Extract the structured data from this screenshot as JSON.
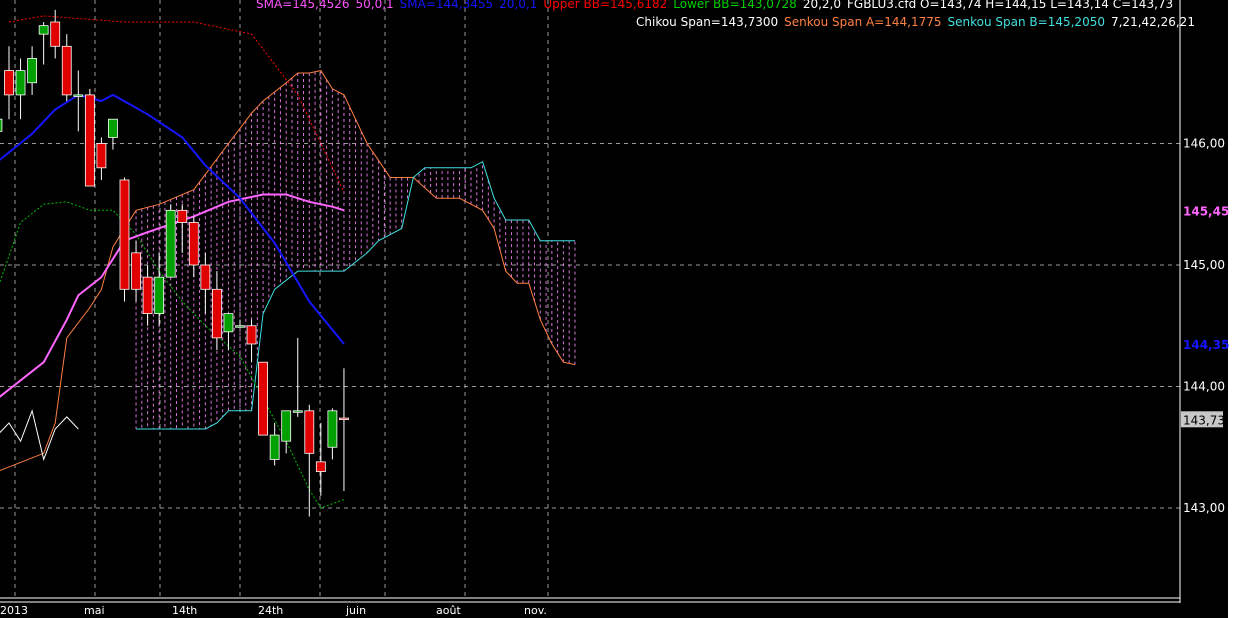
{
  "chart_data": {
    "type": "candlestick",
    "instrument": "FGBLU3.cfd",
    "ohlc_label": "O=143,74 H=144,15 L=143,14 C=143,73",
    "ylim": [
      142.0,
      146.95
    ],
    "grid": true,
    "y_ticks": [
      {
        "label": "146,00",
        "value": 146.0
      },
      {
        "label": "145,00",
        "value": 145.0
      },
      {
        "label": "144,00",
        "value": 144.0
      },
      {
        "label": "143,00",
        "value": 143.0
      }
    ],
    "x_labels": [
      "2013",
      "mai",
      "14th",
      "24th",
      "juin",
      "août",
      "nov."
    ],
    "legends_line1": [
      {
        "text": "SMA=145,4526",
        "color": "#ff55ff"
      },
      {
        "text": "50,0,1",
        "color": "#ff55ff"
      },
      {
        "text": "SMA=144,3455",
        "color": "#1515ff"
      },
      {
        "text": "20,0,1",
        "color": "#1515ff"
      },
      {
        "text": "Upper BB=145,6182",
        "color": "#ff0000"
      },
      {
        "text": "Lower BB=143,0728",
        "color": "#00d000"
      },
      {
        "text": "20,2,0",
        "color": "#ffffff"
      },
      {
        "text": "FGBLU3.cfd O=143,74 H=144,15 L=143,14 C=143,73",
        "color": "#ffffff"
      }
    ],
    "legends_line2": [
      {
        "text": "Chikou Span=143,7300",
        "color": "#ffffff"
      },
      {
        "text": "Senkou Span A=144,1775",
        "color": "#ff8040"
      },
      {
        "text": "Senkou Span B=145,2050",
        "color": "#40e0e0"
      },
      {
        "text": "7,21,42,26,21",
        "color": "#ffffff"
      }
    ],
    "value_tags": [
      {
        "label": "145,45",
        "value": 145.45,
        "color": "#ff66ff"
      },
      {
        "label": "144,35",
        "value": 144.35,
        "color": "#1515ff"
      }
    ],
    "last_price": {
      "label": "143,73",
      "value": 143.73
    },
    "candles": [
      {
        "i": -1,
        "o": 146.1,
        "h": 146.5,
        "l": 145.95,
        "c": 146.2
      },
      {
        "i": 0,
        "o": 146.6,
        "h": 146.8,
        "l": 146.2,
        "c": 146.4
      },
      {
        "i": 1,
        "o": 146.4,
        "h": 146.7,
        "l": 146.2,
        "c": 146.6
      },
      {
        "i": 2,
        "o": 146.5,
        "h": 146.8,
        "l": 146.4,
        "c": 146.7
      },
      {
        "i": 3,
        "o": 146.9,
        "h": 147.0,
        "l": 146.65,
        "c": 146.97
      },
      {
        "i": 4,
        "o": 147.0,
        "h": 147.1,
        "l": 146.7,
        "c": 146.8
      },
      {
        "i": 5,
        "o": 146.8,
        "h": 146.9,
        "l": 146.35,
        "c": 146.4
      },
      {
        "i": 6,
        "o": 146.4,
        "h": 146.6,
        "l": 146.1,
        "c": 146.4
      },
      {
        "i": 7,
        "o": 146.4,
        "h": 146.45,
        "l": 145.65,
        "c": 145.65
      },
      {
        "i": 8,
        "o": 146.0,
        "h": 146.05,
        "l": 145.7,
        "c": 145.8
      },
      {
        "i": 9,
        "o": 146.05,
        "h": 146.2,
        "l": 145.95,
        "c": 146.2
      },
      {
        "i": 10,
        "o": 145.7,
        "h": 145.72,
        "l": 144.7,
        "c": 144.8
      },
      {
        "i": 11,
        "o": 145.1,
        "h": 145.2,
        "l": 144.7,
        "c": 144.8
      },
      {
        "i": 12,
        "o": 144.9,
        "h": 145.0,
        "l": 144.5,
        "c": 144.6
      },
      {
        "i": 13,
        "o": 144.6,
        "h": 145.1,
        "l": 144.5,
        "c": 144.9
      },
      {
        "i": 14,
        "o": 144.9,
        "h": 145.5,
        "l": 144.9,
        "c": 145.45
      },
      {
        "i": 15,
        "o": 145.45,
        "h": 145.5,
        "l": 145.1,
        "c": 145.35
      },
      {
        "i": 16,
        "o": 145.35,
        "h": 145.4,
        "l": 144.9,
        "c": 145.0
      },
      {
        "i": 17,
        "o": 145.0,
        "h": 145.1,
        "l": 144.6,
        "c": 144.8
      },
      {
        "i": 18,
        "o": 144.8,
        "h": 144.95,
        "l": 144.3,
        "c": 144.4
      },
      {
        "i": 19,
        "o": 144.45,
        "h": 144.6,
        "l": 144.3,
        "c": 144.6
      },
      {
        "i": 20,
        "o": 144.5,
        "h": 144.55,
        "l": 144.5,
        "c": 144.5
      },
      {
        "i": 21,
        "o": 144.5,
        "h": 144.55,
        "l": 144.2,
        "c": 144.35
      },
      {
        "i": 22,
        "o": 144.2,
        "h": 144.2,
        "l": 143.6,
        "c": 143.6
      },
      {
        "i": 23,
        "o": 143.4,
        "h": 143.7,
        "l": 143.35,
        "c": 143.6
      },
      {
        "i": 24,
        "o": 143.55,
        "h": 143.8,
        "l": 143.45,
        "c": 143.8
      },
      {
        "i": 25,
        "o": 143.8,
        "h": 144.4,
        "l": 143.75,
        "c": 143.8
      },
      {
        "i": 26,
        "o": 143.8,
        "h": 143.85,
        "l": 142.93,
        "c": 143.45
      },
      {
        "i": 27,
        "o": 143.38,
        "h": 143.7,
        "l": 143.1,
        "c": 143.3
      },
      {
        "i": 28,
        "o": 143.5,
        "h": 143.82,
        "l": 143.4,
        "c": 143.8
      },
      {
        "i": 29,
        "o": 143.74,
        "h": 144.15,
        "l": 143.14,
        "c": 143.73
      }
    ],
    "sma50": [
      {
        "i": -1,
        "v": 143.9
      },
      {
        "i": 3,
        "v": 144.2
      },
      {
        "i": 5,
        "v": 144.55
      },
      {
        "i": 6,
        "v": 144.75
      },
      {
        "i": 8,
        "v": 144.9
      },
      {
        "i": 10,
        "v": 145.2
      },
      {
        "i": 12,
        "v": 145.27
      },
      {
        "i": 16,
        "v": 145.4
      },
      {
        "i": 19,
        "v": 145.52
      },
      {
        "i": 22,
        "v": 145.58
      },
      {
        "i": 24,
        "v": 145.58
      },
      {
        "i": 26,
        "v": 145.52
      },
      {
        "i": 28,
        "v": 145.48
      },
      {
        "i": 29,
        "v": 145.45
      }
    ],
    "sma20": [
      {
        "i": -1,
        "v": 145.85
      },
      {
        "i": 2,
        "v": 146.08
      },
      {
        "i": 4,
        "v": 146.28
      },
      {
        "i": 6,
        "v": 146.4
      },
      {
        "i": 8,
        "v": 146.35
      },
      {
        "i": 9,
        "v": 146.4
      },
      {
        "i": 12,
        "v": 146.24
      },
      {
        "i": 15,
        "v": 146.05
      },
      {
        "i": 17,
        "v": 145.82
      },
      {
        "i": 20,
        "v": 145.55
      },
      {
        "i": 23,
        "v": 145.18
      },
      {
        "i": 26,
        "v": 144.7
      },
      {
        "i": 29,
        "v": 144.35
      }
    ],
    "upper_bb": [
      {
        "i": 0,
        "v": 147.0
      },
      {
        "i": 3,
        "v": 147.05
      },
      {
        "i": 10,
        "v": 147.0
      },
      {
        "i": 16,
        "v": 147.0
      },
      {
        "i": 21,
        "v": 146.9
      },
      {
        "i": 23,
        "v": 146.65
      },
      {
        "i": 25,
        "v": 146.4
      },
      {
        "i": 27,
        "v": 146.0
      },
      {
        "i": 29,
        "v": 145.6
      }
    ],
    "lower_bb": [
      {
        "i": -1,
        "v": 144.8
      },
      {
        "i": 1,
        "v": 145.35
      },
      {
        "i": 3,
        "v": 145.5
      },
      {
        "i": 5,
        "v": 145.52
      },
      {
        "i": 7,
        "v": 145.45
      },
      {
        "i": 9,
        "v": 145.45
      },
      {
        "i": 11,
        "v": 145.25
      },
      {
        "i": 13,
        "v": 144.95
      },
      {
        "i": 15,
        "v": 144.7
      },
      {
        "i": 17,
        "v": 144.5
      },
      {
        "i": 20,
        "v": 144.25
      },
      {
        "i": 22,
        "v": 143.9
      },
      {
        "i": 24,
        "v": 143.55
      },
      {
        "i": 26,
        "v": 143.15
      },
      {
        "i": 27,
        "v": 143.0
      },
      {
        "i": 29,
        "v": 143.07
      }
    ],
    "chikou": [
      {
        "i": -1,
        "v": 143.6
      },
      {
        "i": 0,
        "v": 143.7
      },
      {
        "i": 1,
        "v": 143.55
      },
      {
        "i": 2,
        "v": 143.8
      },
      {
        "i": 3,
        "v": 143.4
      },
      {
        "i": 4,
        "v": 143.65
      },
      {
        "i": 5,
        "v": 143.75
      },
      {
        "i": 6,
        "v": 143.65
      }
    ],
    "senkou_a": [
      {
        "i": -1,
        "v": 143.3
      },
      {
        "i": 3,
        "v": 143.45
      },
      {
        "i": 4,
        "v": 143.7
      },
      {
        "i": 5,
        "v": 144.4
      },
      {
        "i": 7,
        "v": 144.65
      },
      {
        "i": 8,
        "v": 144.8
      },
      {
        "i": 9,
        "v": 145.15
      },
      {
        "i": 10,
        "v": 145.3
      },
      {
        "i": 11,
        "v": 145.45
      },
      {
        "i": 13,
        "v": 145.5
      },
      {
        "i": 16,
        "v": 145.62
      },
      {
        "i": 19,
        "v": 146.0
      },
      {
        "i": 21,
        "v": 146.25
      },
      {
        "i": 22,
        "v": 146.35
      },
      {
        "i": 24,
        "v": 146.5
      },
      {
        "i": 25,
        "v": 146.58
      },
      {
        "i": 26,
        "v": 146.58
      },
      {
        "i": 27,
        "v": 146.6
      },
      {
        "i": 28,
        "v": 146.45
      },
      {
        "i": 29,
        "v": 146.4
      },
      {
        "i": 31,
        "v": 146.0
      },
      {
        "i": 33,
        "v": 145.72
      },
      {
        "i": 35,
        "v": 145.72
      },
      {
        "i": 37,
        "v": 145.55
      },
      {
        "i": 39,
        "v": 145.55
      },
      {
        "i": 41,
        "v": 145.45
      },
      {
        "i": 42,
        "v": 145.3
      },
      {
        "i": 43,
        "v": 144.95
      },
      {
        "i": 44,
        "v": 144.85
      },
      {
        "i": 45,
        "v": 144.85
      },
      {
        "i": 46,
        "v": 144.55
      },
      {
        "i": 47,
        "v": 144.35
      },
      {
        "i": 48,
        "v": 144.2
      },
      {
        "i": 49,
        "v": 144.18
      }
    ],
    "senkou_b": [
      {
        "i": 11,
        "v": 143.65
      },
      {
        "i": 17,
        "v": 143.65
      },
      {
        "i": 18,
        "v": 143.7
      },
      {
        "i": 19,
        "v": 143.8
      },
      {
        "i": 21,
        "v": 143.8
      },
      {
        "i": 22,
        "v": 144.6
      },
      {
        "i": 23,
        "v": 144.8
      },
      {
        "i": 25,
        "v": 144.95
      },
      {
        "i": 29,
        "v": 144.95
      },
      {
        "i": 31,
        "v": 145.1
      },
      {
        "i": 32,
        "v": 145.2
      },
      {
        "i": 33,
        "v": 145.25
      },
      {
        "i": 34,
        "v": 145.3
      },
      {
        "i": 35,
        "v": 145.72
      },
      {
        "i": 36,
        "v": 145.8
      },
      {
        "i": 40,
        "v": 145.8
      },
      {
        "i": 41,
        "v": 145.85
      },
      {
        "i": 42,
        "v": 145.55
      },
      {
        "i": 43,
        "v": 145.37
      },
      {
        "i": 45,
        "v": 145.37
      },
      {
        "i": 46,
        "v": 145.2
      },
      {
        "i": 49,
        "v": 145.2
      }
    ],
    "colors": {
      "background": "#000000",
      "grid": "#9a9a9a",
      "up_candle": "#00a000",
      "down_candle": "#e00000",
      "wick": "#ffffff",
      "sma50": "#ff66ff",
      "sma20": "#1515ff",
      "upper_bb": "#ff0000",
      "lower_bb": "#00c000",
      "chikou": "#ffffff",
      "senkou_a": "#ff8040",
      "senkou_b": "#40e0e0",
      "cloud_hatch": "#ff88ff"
    }
  }
}
